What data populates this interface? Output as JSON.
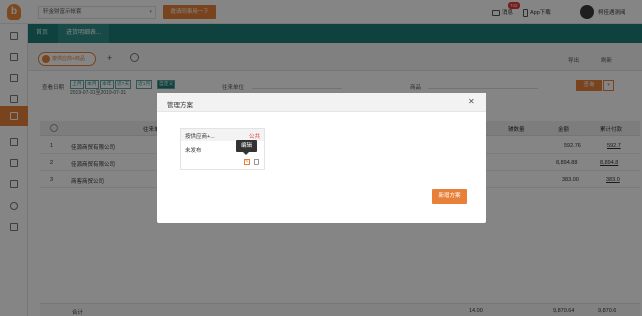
{
  "topbar": {
    "logo_letter": "b",
    "account_select": "轩金财富示帐套",
    "invite_button": "邀请同事用一下",
    "message_label": "消息",
    "message_badge": "742",
    "app_download": "App下载",
    "user_name": "柯佳遇测阅"
  },
  "nav": {
    "tabs": [
      "首页",
      "进货明细表..."
    ]
  },
  "page": {
    "scheme_tab": "按供应商+商品",
    "export_label": "导出",
    "refresh_label": "刷新"
  },
  "filter": {
    "date_label": "查看日期",
    "range_buttons": [
      "上月",
      "本月",
      "本年",
      "近7天",
      "近1月",
      "自定义"
    ],
    "date_range": "2019-07-31至2019-07-31",
    "supplier_label": "往来单位",
    "product_label": "商品",
    "query_button": "查询"
  },
  "table": {
    "headers": [
      "往来单位",
      "辅数量",
      "金额",
      "累计付款"
    ],
    "rows": [
      {
        "index": "1",
        "supplier": "佳源商贸有限公司",
        "amount": "592.76",
        "paid": "592.7"
      },
      {
        "index": "2",
        "supplier": "佳源商贸有限公司",
        "amount": "8,894.88",
        "paid": "8,894.8"
      },
      {
        "index": "3",
        "supplier": "商客商贸公司",
        "amount": "383.00",
        "paid": "383.0"
      }
    ],
    "total_label": "合计",
    "total_qty": "14.00",
    "total_amount": "9,870.64",
    "total_paid": "9,870.6"
  },
  "modal": {
    "title": "管理方案",
    "card_name": "按供应商+...",
    "card_public": "公共",
    "card_status": "未发布",
    "tooltip": "编辑",
    "new_button": "新增方案"
  },
  "colors": {
    "accent": "#e8803a",
    "nav_teal": "#1d7f7a",
    "danger": "#e53935"
  }
}
